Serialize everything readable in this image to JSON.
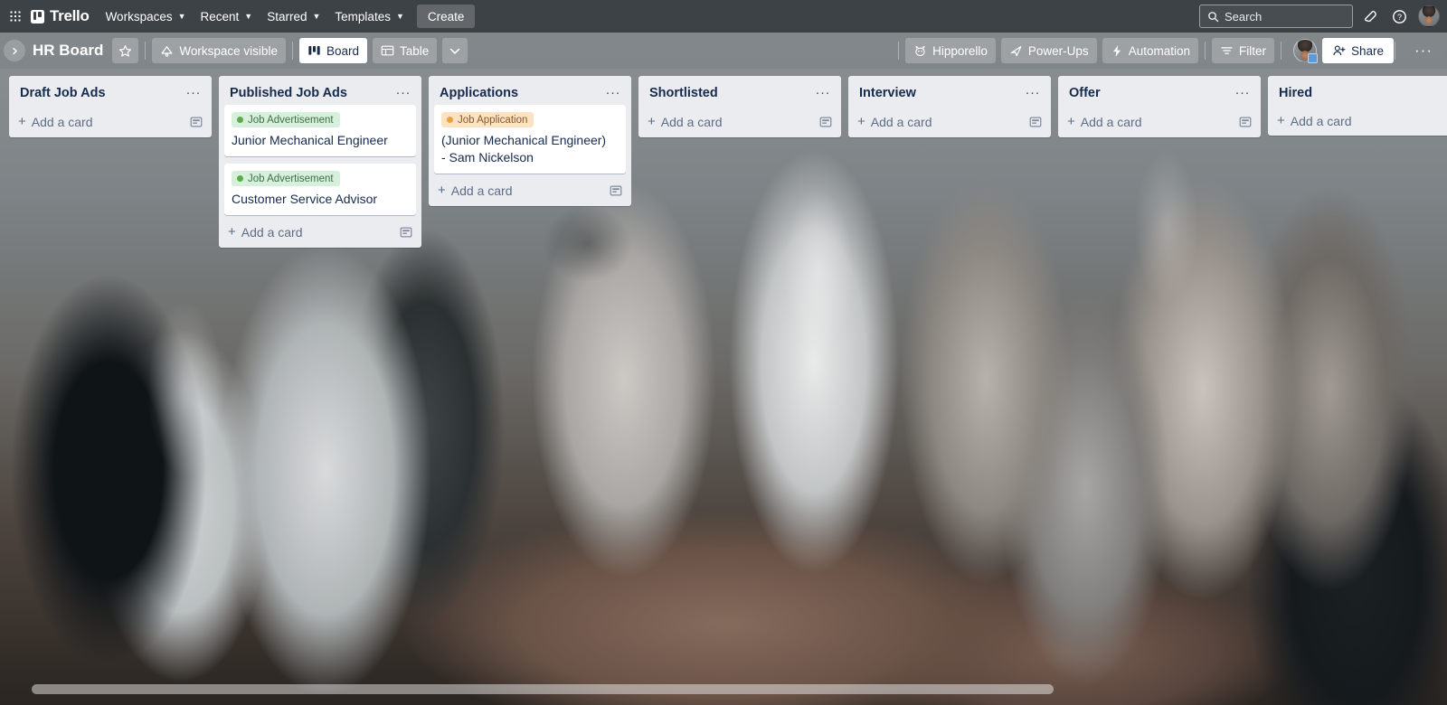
{
  "topbar": {
    "apps_icon": "grid-apps-icon",
    "logo_text": "Trello",
    "nav": [
      {
        "label": "Workspaces",
        "has_chevron": true
      },
      {
        "label": "Recent",
        "has_chevron": true
      },
      {
        "label": "Starred",
        "has_chevron": true
      },
      {
        "label": "Templates",
        "has_chevron": true
      }
    ],
    "create_label": "Create",
    "search_placeholder": "Search",
    "notifications_icon": "bell-icon",
    "help_icon": "help-circle-icon",
    "avatar_icon": "user-avatar"
  },
  "boardbar": {
    "collapse_icon": "chevron-right-icon",
    "title": "HR Board",
    "star_icon": "star-icon",
    "visibility_label": "Workspace visible",
    "visibility_icon": "workspace-visible-icon",
    "views": [
      {
        "label": "Board",
        "icon": "board-view-icon",
        "active": true
      },
      {
        "label": "Table",
        "icon": "table-view-icon",
        "active": false
      }
    ],
    "views_chevron": "chevron-down-icon",
    "hipporello_label": "Hipporello",
    "hipporello_icon": "hipporello-icon",
    "powerups_label": "Power-Ups",
    "powerups_icon": "powerup-rocket-icon",
    "automation_label": "Automation",
    "automation_icon": "lightning-bolt-icon",
    "filter_label": "Filter",
    "filter_icon": "filter-icon",
    "member_avatar": "board-member-avatar",
    "share_label": "Share",
    "share_icon": "person-add-icon",
    "more_label": "···"
  },
  "common": {
    "add_card_label": "Add a card",
    "list_menu_label": "···",
    "template_icon": "card-template-icon",
    "plus_icon": "plus-icon"
  },
  "lists": [
    {
      "name": "Draft Job Ads",
      "has_menu": true,
      "has_template_icon": true,
      "cards": []
    },
    {
      "name": "Published Job Ads",
      "has_menu": true,
      "has_template_icon": true,
      "cards": [
        {
          "label": "Job Advertisement",
          "label_color": "green",
          "title": "Junior Mechanical Engineer"
        },
        {
          "label": "Job Advertisement",
          "label_color": "green",
          "title": "Customer Service Advisor"
        }
      ]
    },
    {
      "name": "Applications",
      "has_menu": true,
      "has_template_icon": true,
      "cards": [
        {
          "label": "Job Application",
          "label_color": "orange",
          "title": "(Junior Mechanical Engineer)\n- Sam Nickelson"
        }
      ]
    },
    {
      "name": "Shortlisted",
      "has_menu": true,
      "has_template_icon": true,
      "cards": []
    },
    {
      "name": "Interview",
      "has_menu": true,
      "has_template_icon": true,
      "cards": []
    },
    {
      "name": "Offer",
      "has_menu": true,
      "has_template_icon": true,
      "cards": []
    },
    {
      "name": "Hired",
      "has_menu": false,
      "has_template_icon": false,
      "cards": []
    }
  ],
  "colors": {
    "topbar_bg": "#3d4247",
    "list_bg": "#ebecf0",
    "card_bg": "#ffffff",
    "text_primary": "#172b4d",
    "text_muted": "#5e6c84",
    "label_green_bg": "#d6f0dc",
    "label_green_dot": "#5aac44",
    "label_orange_bg": "#fbe2c3",
    "label_orange_dot": "#e8a33d"
  },
  "scrollbar": {
    "name": "horizontal-scrollbar"
  }
}
